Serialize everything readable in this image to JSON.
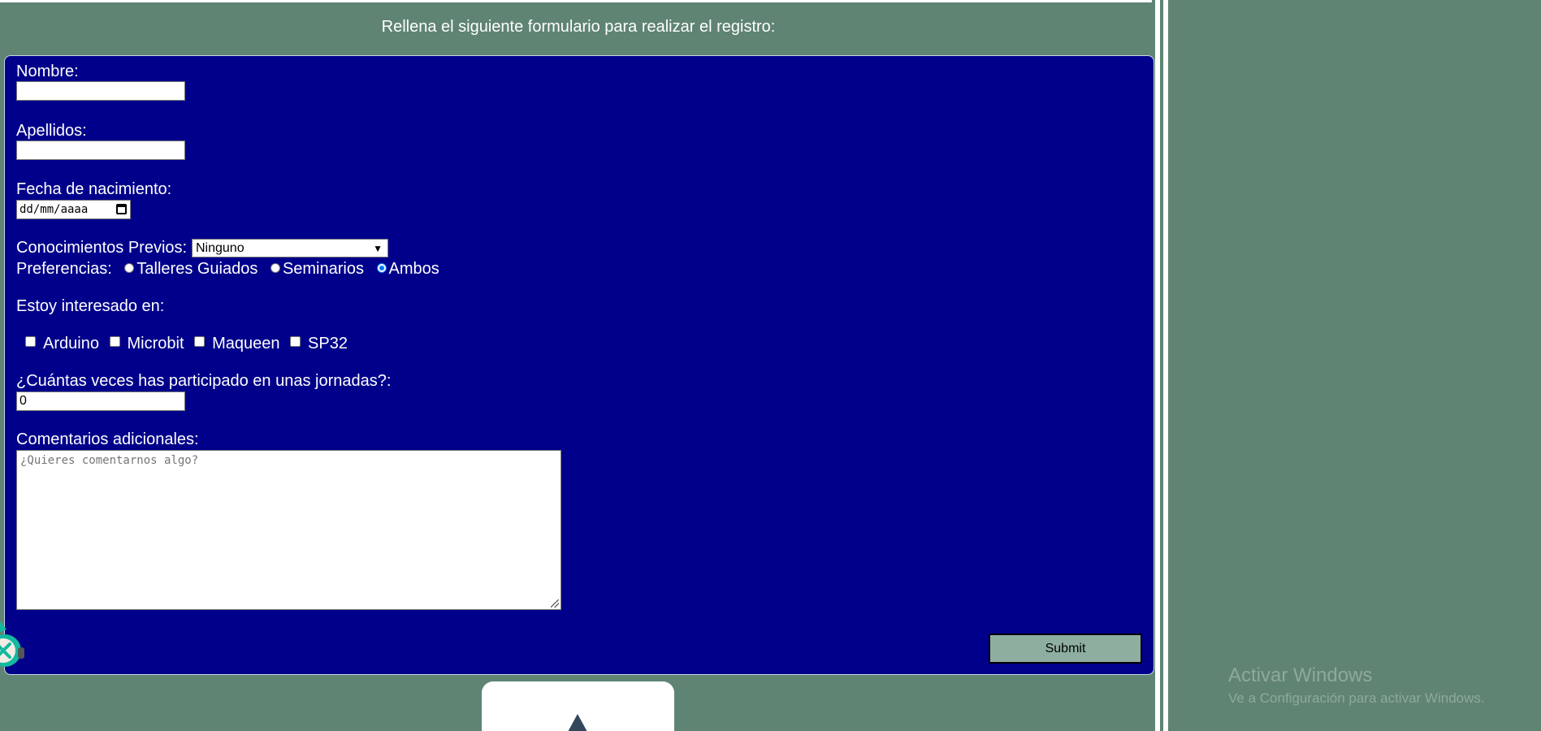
{
  "intro_text": "Rellena el siguiente formulario para realizar el registro:",
  "form": {
    "nombre_label": "Nombre:",
    "nombre_value": "",
    "apellidos_label": "Apellidos:",
    "apellidos_value": "",
    "fecha_label": "Fecha de nacimiento:",
    "fecha_placeholder": "dd/mm/aaaa",
    "conocimientos_label": "Conocimientos Previos:",
    "conocimientos_selected": "Ninguno",
    "preferencias_label": "Preferencias:",
    "preferencias_options": [
      {
        "label": "Talleres Guiados",
        "checked": false
      },
      {
        "label": "Seminarios",
        "checked": false
      },
      {
        "label": "Ambos",
        "checked": true
      }
    ],
    "interesado_label": "Estoy interesado en:",
    "interests": [
      {
        "label": "Arduino",
        "checked": false
      },
      {
        "label": "Microbit",
        "checked": false
      },
      {
        "label": "Maqueen",
        "checked": false
      },
      {
        "label": "SP32",
        "checked": false
      }
    ],
    "veces_label": "¿Cuántas veces has participado en unas jornadas?:",
    "veces_value": "0",
    "comentarios_label": "Comentarios adicionales:",
    "comentarios_placeholder": "¿Quieres comentarnos algo?",
    "submit_label": "Submit"
  },
  "watermark": {
    "title": "Activar Windows",
    "subtitle": "Ve a Configuración para activar Windows."
  },
  "colors": {
    "page_bg": "#5f8473",
    "form_bg": "#00008b",
    "submit_bg": "#8eaf9f",
    "radio_checked": "#0075ff"
  },
  "icons": {
    "robot": "robot-mascot-icon",
    "scroll_top": "triangle-up-icon",
    "calendar": "calendar-icon",
    "dropdown": "chevron-down-icon"
  }
}
